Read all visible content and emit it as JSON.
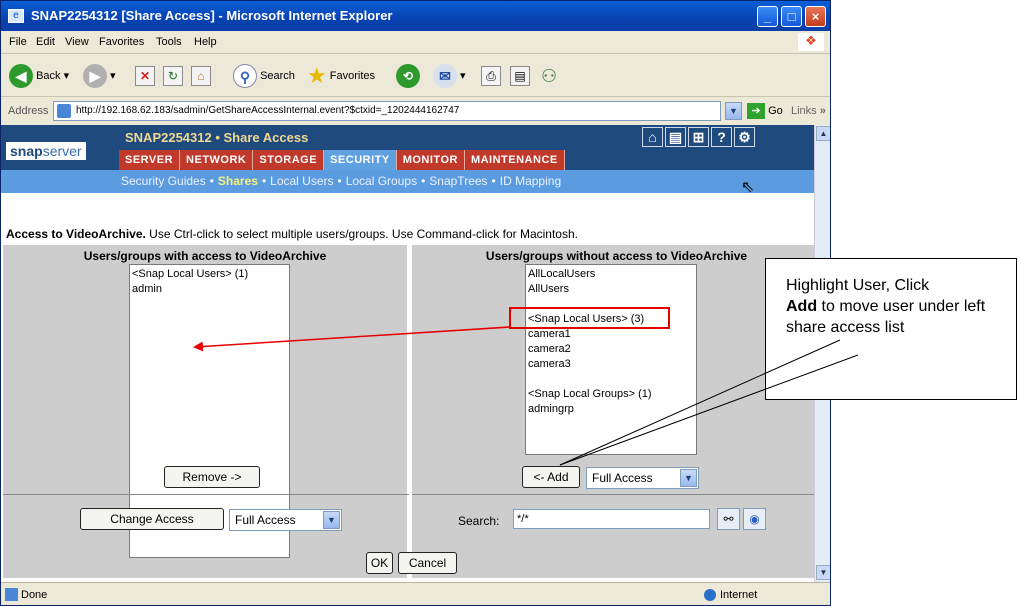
{
  "window": {
    "title": "SNAP2254312 [Share Access] - Microsoft Internet Explorer",
    "controls": [
      "_",
      "□",
      "×"
    ]
  },
  "menu": [
    "File",
    "Edit",
    "View",
    "Favorites",
    "Tools",
    "Help"
  ],
  "toolbar": {
    "back": "Back",
    "search": "Search",
    "favorites": "Favorites"
  },
  "address": {
    "label": "Address",
    "url": "http://192.168.62.183/sadmin/GetShareAccessInternal.event?$ctxid=_1202444162747",
    "go": "Go",
    "links": "Links",
    "links_more": "»"
  },
  "app": {
    "logo_main": "snap",
    "logo_rest": "server",
    "page_title": "SNAP2254312 • Share Access",
    "header_icons": [
      "⌂",
      "▤",
      "⊞",
      "?",
      "⚙"
    ],
    "tabs": [
      {
        "label": "SERVER",
        "active": false
      },
      {
        "label": "NETWORK",
        "active": false
      },
      {
        "label": "STORAGE",
        "active": false
      },
      {
        "label": "SECURITY",
        "active": true
      },
      {
        "label": "MONITOR",
        "active": false
      },
      {
        "label": "MAINTENANCE",
        "active": false
      }
    ],
    "subnav": [
      "Security Guides",
      "Shares",
      "Local Users",
      "Local Groups",
      "SnapTrees",
      "ID Mapping"
    ],
    "subnav_active": "Shares"
  },
  "info": {
    "bold": "Access to VideoArchive.",
    "text": " Use Ctrl-click to select multiple users/groups. Use Command-click for Macintosh."
  },
  "left_panel": {
    "title": "Users/groups with access to VideoArchive",
    "items": [
      "<Snap Local Users> (1)",
      "admin"
    ],
    "remove_button": "Remove ->",
    "change_access_button": "Change Access",
    "access_select": "Full Access"
  },
  "right_panel": {
    "title": "Users/groups without access to VideoArchive",
    "items": [
      "AllLocalUsers",
      "AllUsers",
      "",
      "<Snap Local Users> (3)",
      "camera1",
      "camera2",
      "camera3",
      "",
      "<Snap Local Groups> (1)",
      "admingrp"
    ],
    "add_button": "<- Add",
    "access_select": "Full Access",
    "search_label": "Search:",
    "search_value": "*/*"
  },
  "dialog": {
    "ok": "OK",
    "cancel": "Cancel"
  },
  "status": {
    "text": "Done",
    "zone": "Internet"
  },
  "callout": {
    "line1": "Highlight User, Click",
    "bold": "Add",
    "line2": " to move user under left share access list"
  },
  "colors": {
    "header_bg": "#1f4a7e",
    "tab_bg": "#c0392b",
    "tab_active": "#5fa0e0",
    "subnav_bg": "#5b9be0",
    "annotation_red": "#e60000"
  }
}
